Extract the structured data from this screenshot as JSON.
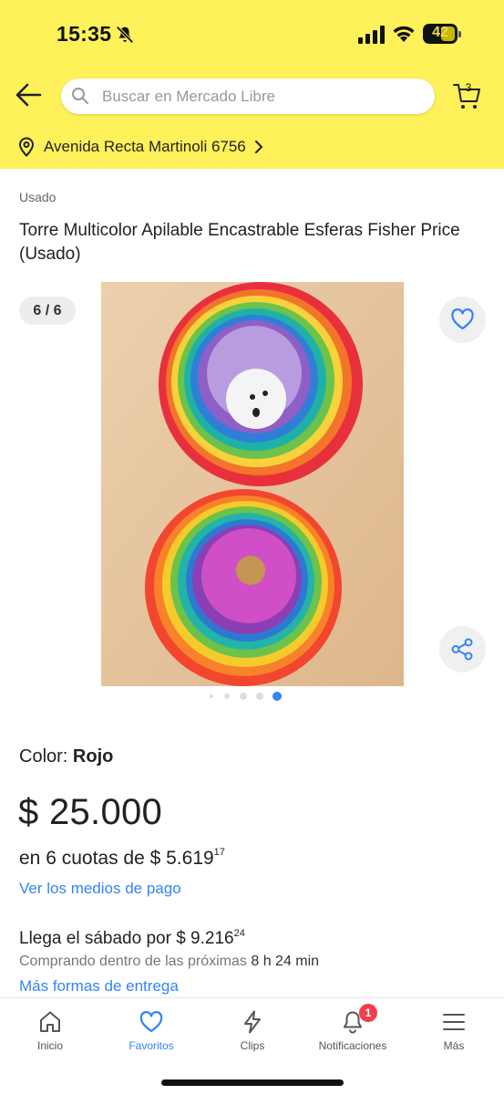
{
  "status_bar": {
    "time": "15:35",
    "battery": "42",
    "icons": [
      "bell-slash-icon",
      "signal-icon",
      "wifi-icon",
      "battery-icon"
    ]
  },
  "header": {
    "search_placeholder": "Buscar en Mercado Libre",
    "cart_count": "3",
    "address": "Avenida Recta Martinoli 6756",
    "brand_color": "#fff159"
  },
  "product": {
    "condition": "Usado",
    "title": "Torre Multicolor Apilable Encastrable Esferas Fisher Price (Usado)",
    "gallery_counter": "6 / 6",
    "gallery_total": 6,
    "gallery_current": 6,
    "color_label": "Color: ",
    "color_value": "Rojo",
    "price": "$ 25.000",
    "installments_prefix": "en 6 cuotas de $ 5.619",
    "installments_cents": "17",
    "payment_link": "Ver los medios de pago",
    "delivery_prefix": "Llega el sábado por $ 9.216",
    "delivery_cents": "24",
    "delivery_sub_prefix": "Comprando dentro de las próximas",
    "delivery_sub_time": "8 h 24 min",
    "more_delivery_link": "Más formas de entrega"
  },
  "tabbar": {
    "items": [
      {
        "label": "Inicio",
        "icon": "home-icon"
      },
      {
        "label": "Favoritos",
        "icon": "heart-icon",
        "active": true
      },
      {
        "label": "Clips",
        "icon": "lightning-icon"
      },
      {
        "label": "Notificaciones",
        "icon": "bell-icon",
        "badge": "1"
      },
      {
        "label": "Más",
        "icon": "menu-icon"
      }
    ]
  },
  "colors": {
    "link": "#3483fa",
    "badge": "#f23d4f"
  }
}
